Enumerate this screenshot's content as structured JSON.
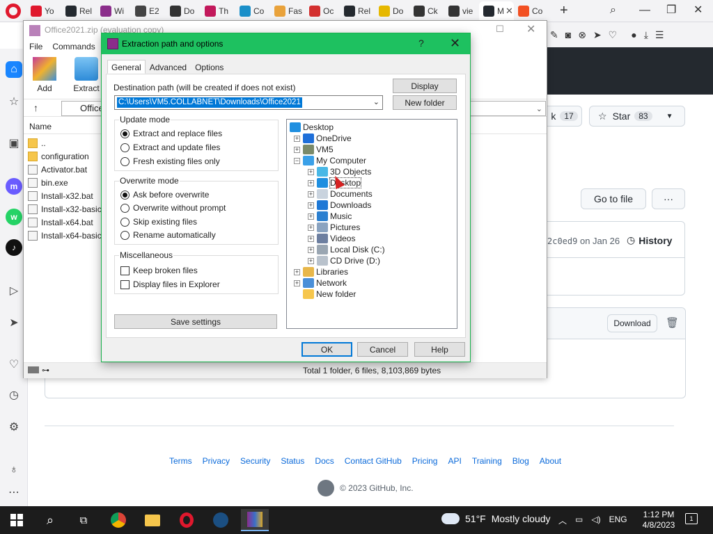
{
  "browser": {
    "tabs": [
      {
        "label": "Yo",
        "icon": "opera-icon",
        "color": "#e0182d"
      },
      {
        "label": "Rel",
        "icon": "github-icon",
        "color": "#24292f"
      },
      {
        "label": "Wi",
        "icon": "winrar-icon",
        "color": "#8b2d8b"
      },
      {
        "label": "E2",
        "icon": "globe-icon",
        "color": "#444444"
      },
      {
        "label": "Do",
        "icon": "7zip-icon",
        "color": "#333333"
      },
      {
        "label": "Th",
        "icon": "arc-icon",
        "color": "#c2185b"
      },
      {
        "label": "Co",
        "icon": "monitor-icon",
        "color": "#1a8fc9"
      },
      {
        "label": "Fas",
        "icon": "stack-icon",
        "color": "#e9a23b"
      },
      {
        "label": "Oc",
        "icon": "yandex-icon",
        "color": "#d32f2f"
      },
      {
        "label": "Rel",
        "icon": "github-icon",
        "color": "#24292f"
      },
      {
        "label": "Do",
        "icon": "d-icon",
        "color": "#e6b800"
      },
      {
        "label": "Ck",
        "icon": "m-icon",
        "color": "#333333"
      },
      {
        "label": "vie",
        "icon": "m-icon",
        "color": "#333333"
      },
      {
        "label": "M",
        "icon": "github-icon",
        "color": "#24292f",
        "active": true
      },
      {
        "label": "Co",
        "icon": "microsoft-icon",
        "color": "#f25022"
      }
    ],
    "new_tab": "+"
  },
  "github": {
    "fork_label": "k",
    "fork_count": "17",
    "star_label": "Star",
    "star_count": "83",
    "goto_file": "Go to file",
    "more": "···",
    "commit_hash": "2c0ed9",
    "commit_date": " on Jan 26",
    "history": "History",
    "download": "Download",
    "footer_links": [
      "Terms",
      "Privacy",
      "Security",
      "Status",
      "Docs",
      "Contact GitHub",
      "Pricing",
      "API",
      "Training",
      "Blog",
      "About"
    ],
    "copyright": "© 2023 GitHub, Inc."
  },
  "winrar": {
    "title": "Office2021.zip (evaluation copy)",
    "menu": [
      "File",
      "Commands"
    ],
    "tools": [
      {
        "label": "Add"
      },
      {
        "label": "Extract"
      }
    ],
    "address": "Office",
    "col_name": "Name",
    "files": [
      {
        "name": "..",
        "type": "folder"
      },
      {
        "name": "configuration",
        "type": "folder"
      },
      {
        "name": "Activator.bat",
        "type": "file"
      },
      {
        "name": "bin.exe",
        "type": "file"
      },
      {
        "name": "Install-x32.bat",
        "type": "file"
      },
      {
        "name": "Install-x32-basic",
        "type": "file"
      },
      {
        "name": "Install-x64.bat",
        "type": "file"
      },
      {
        "name": "Install-x64-basic",
        "type": "file"
      }
    ],
    "status": "Total 1 folder, 6 files, 8,103,869 bytes"
  },
  "dialog": {
    "title": "Extraction path and options",
    "help_glyph": "?",
    "tabs": [
      "General",
      "Advanced",
      "Options"
    ],
    "dest_label": "Destination path (will be created if does not exist)",
    "dest_value": "C:\\Users\\VM5.COLLABNET\\Downloads\\Office2021",
    "display_btn": "Display",
    "new_folder_btn": "New folder",
    "update_mode": {
      "title": "Update mode",
      "options": [
        "Extract and replace files",
        "Extract and update files",
        "Fresh existing files only"
      ],
      "selected": 0
    },
    "overwrite_mode": {
      "title": "Overwrite mode",
      "options": [
        "Ask before overwrite",
        "Overwrite without prompt",
        "Skip existing files",
        "Rename automatically"
      ],
      "selected": 0
    },
    "misc": {
      "title": "Miscellaneous",
      "options": [
        "Keep broken files",
        "Display files in Explorer"
      ]
    },
    "save_settings": "Save settings",
    "tree": [
      {
        "label": "Desktop",
        "level": 0,
        "expander": "",
        "icon": "desktop-icon",
        "color": "#1f8fe0"
      },
      {
        "label": "OneDrive",
        "level": 1,
        "expander": "+",
        "icon": "onedrive-icon",
        "color": "#1e6fd9"
      },
      {
        "label": "VM5",
        "level": 1,
        "expander": "+",
        "icon": "user-icon",
        "color": "#7a8a6a"
      },
      {
        "label": "My Computer",
        "level": 1,
        "expander": "−",
        "icon": "computer-icon",
        "color": "#3aa0e8"
      },
      {
        "label": "3D Objects",
        "level": 2,
        "expander": "+",
        "icon": "3d-objects-icon",
        "color": "#49b8e6"
      },
      {
        "label": "Desktop",
        "level": 2,
        "expander": "+",
        "icon": "desktop-icon",
        "color": "#1f8fe0",
        "selected": true
      },
      {
        "label": "Documents",
        "level": 2,
        "expander": "+",
        "icon": "documents-icon",
        "color": "#c9d3de"
      },
      {
        "label": "Downloads",
        "level": 2,
        "expander": "+",
        "icon": "downloads-icon",
        "color": "#1e78d6"
      },
      {
        "label": "Music",
        "level": 2,
        "expander": "+",
        "icon": "music-icon",
        "color": "#2a7fd0"
      },
      {
        "label": "Pictures",
        "level": 2,
        "expander": "+",
        "icon": "pictures-icon",
        "color": "#8aa3c0"
      },
      {
        "label": "Videos",
        "level": 2,
        "expander": "+",
        "icon": "videos-icon",
        "color": "#6d7fa0"
      },
      {
        "label": "Local Disk (C:)",
        "level": 2,
        "expander": "+",
        "icon": "disk-icon",
        "color": "#9aa6b2"
      },
      {
        "label": "CD Drive (D:)",
        "level": 2,
        "expander": "+",
        "icon": "cd-icon",
        "color": "#b9c2cc"
      },
      {
        "label": "Libraries",
        "level": 1,
        "expander": "+",
        "icon": "libraries-icon",
        "color": "#e8b74a"
      },
      {
        "label": "Network",
        "level": 1,
        "expander": "+",
        "icon": "network-icon",
        "color": "#4a8fd8"
      },
      {
        "label": "New folder",
        "level": 1,
        "expander": "",
        "icon": "folder-icon",
        "color": "#f6c64c"
      }
    ],
    "ok": "OK",
    "cancel": "Cancel",
    "help": "Help"
  },
  "taskbar": {
    "temperature": "51°F",
    "weather": "Mostly cloudy",
    "language": "ENG",
    "time": "1:12 PM",
    "date": "4/8/2023",
    "notifications": "1"
  }
}
